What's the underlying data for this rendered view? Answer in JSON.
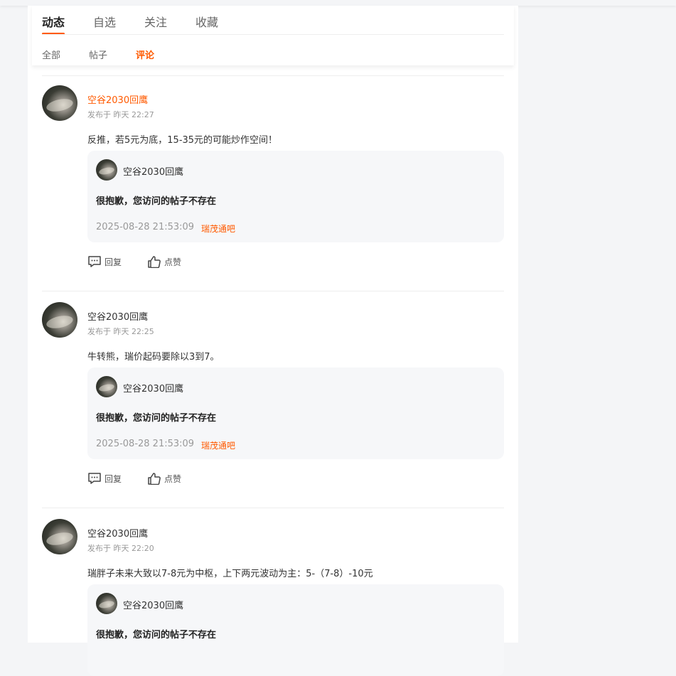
{
  "tabs": {
    "main": [
      "动态",
      "自选",
      "关注",
      "收藏"
    ],
    "sub": [
      "全部",
      "帖子",
      "评论"
    ]
  },
  "labels": {
    "reply": "回复",
    "like": "点赞"
  },
  "feed": [
    {
      "username": "空谷2030回鹰",
      "time": "发布于 昨天 22:27",
      "content": "反推，若5元为底，15-35元的可能炒作空间！",
      "quote": {
        "name": "空谷2030回鹰",
        "title": "很抱歉，您访问的帖子不存在",
        "date": "2025-08-28 21:53:09",
        "bar": "瑞茂通吧"
      }
    },
    {
      "username": "空谷2030回鹰",
      "time": "发布于 昨天 22:25",
      "content": "牛转熊，瑞价起码要除以3到7。",
      "quote": {
        "name": "空谷2030回鹰",
        "title": "很抱歉，您访问的帖子不存在",
        "date": "2025-08-28 21:53:09",
        "bar": "瑞茂通吧"
      }
    },
    {
      "username": "空谷2030回鹰",
      "time": "发布于 昨天 22:20",
      "content": "瑞胖子未来大致以7-8元为中枢，上下两元波动为主：5-（7-8）-10元",
      "quote": {
        "name": "空谷2030回鹰",
        "title": "很抱歉，您访问的帖子不存在",
        "date": "",
        "bar": ""
      }
    }
  ],
  "colors": {
    "accent": "#ff5a00",
    "muted": "#999999",
    "quote_bg": "#f6f7f9"
  }
}
